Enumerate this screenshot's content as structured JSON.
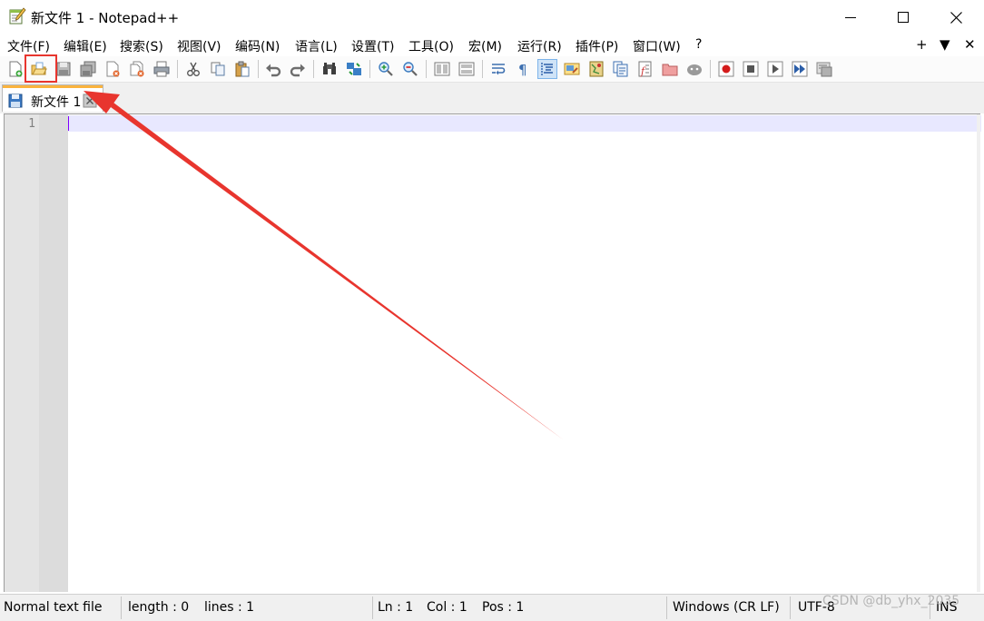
{
  "window": {
    "title": "新文件 1 - Notepad++",
    "controls": [
      "minimize",
      "maximize",
      "close"
    ]
  },
  "menu": {
    "items": [
      "文件(F)",
      "编辑(E)",
      "搜索(S)",
      "视图(V)",
      "编码(N)",
      "语言(L)",
      "设置(T)",
      "工具(O)",
      "宏(M)",
      "运行(R)",
      "插件(P)",
      "窗口(W)",
      "?"
    ],
    "right": [
      "+",
      "▼",
      "✕"
    ]
  },
  "toolbar": {
    "icons": [
      "new-file-icon",
      "open-file-icon",
      "save-icon",
      "save-all-icon",
      "close-icon",
      "close-all-icon",
      "print-icon",
      "cut-icon",
      "copy-icon",
      "paste-icon",
      "undo-icon",
      "redo-icon",
      "find-icon",
      "replace-icon",
      "zoom-in-icon",
      "zoom-out-icon",
      "sync-vertical-icon",
      "sync-horizontal-icon",
      "word-wrap-icon",
      "show-all-chars-icon",
      "indent-guide-icon",
      "user-language-icon",
      "document-map-icon",
      "document-list-icon",
      "function-list-icon",
      "folder-workspace-icon",
      "monitoring-icon",
      "record-macro-icon",
      "stop-record-icon",
      "play-macro-icon",
      "run-macro-multiple-icon",
      "save-macro-icon"
    ]
  },
  "tabs": [
    {
      "label": "新文件 1",
      "active": true
    }
  ],
  "editor": {
    "line_numbers": [
      "1"
    ],
    "content": ""
  },
  "status": {
    "file_type": "Normal text file",
    "length": "length : 0",
    "lines": "lines : 1",
    "ln": "Ln : 1",
    "col": "Col : 1",
    "pos": "Pos : 1",
    "eol": "Windows (CR LF)",
    "encoding": "UTF-8",
    "mode": "INS"
  },
  "watermark": "CSDN @db_yhx_2035",
  "annotation": {
    "color": "#e8352e"
  },
  "colors": {
    "tab_accent": "#fab33d",
    "current_line": "#e8e8ff",
    "caret": "#8000ff"
  }
}
